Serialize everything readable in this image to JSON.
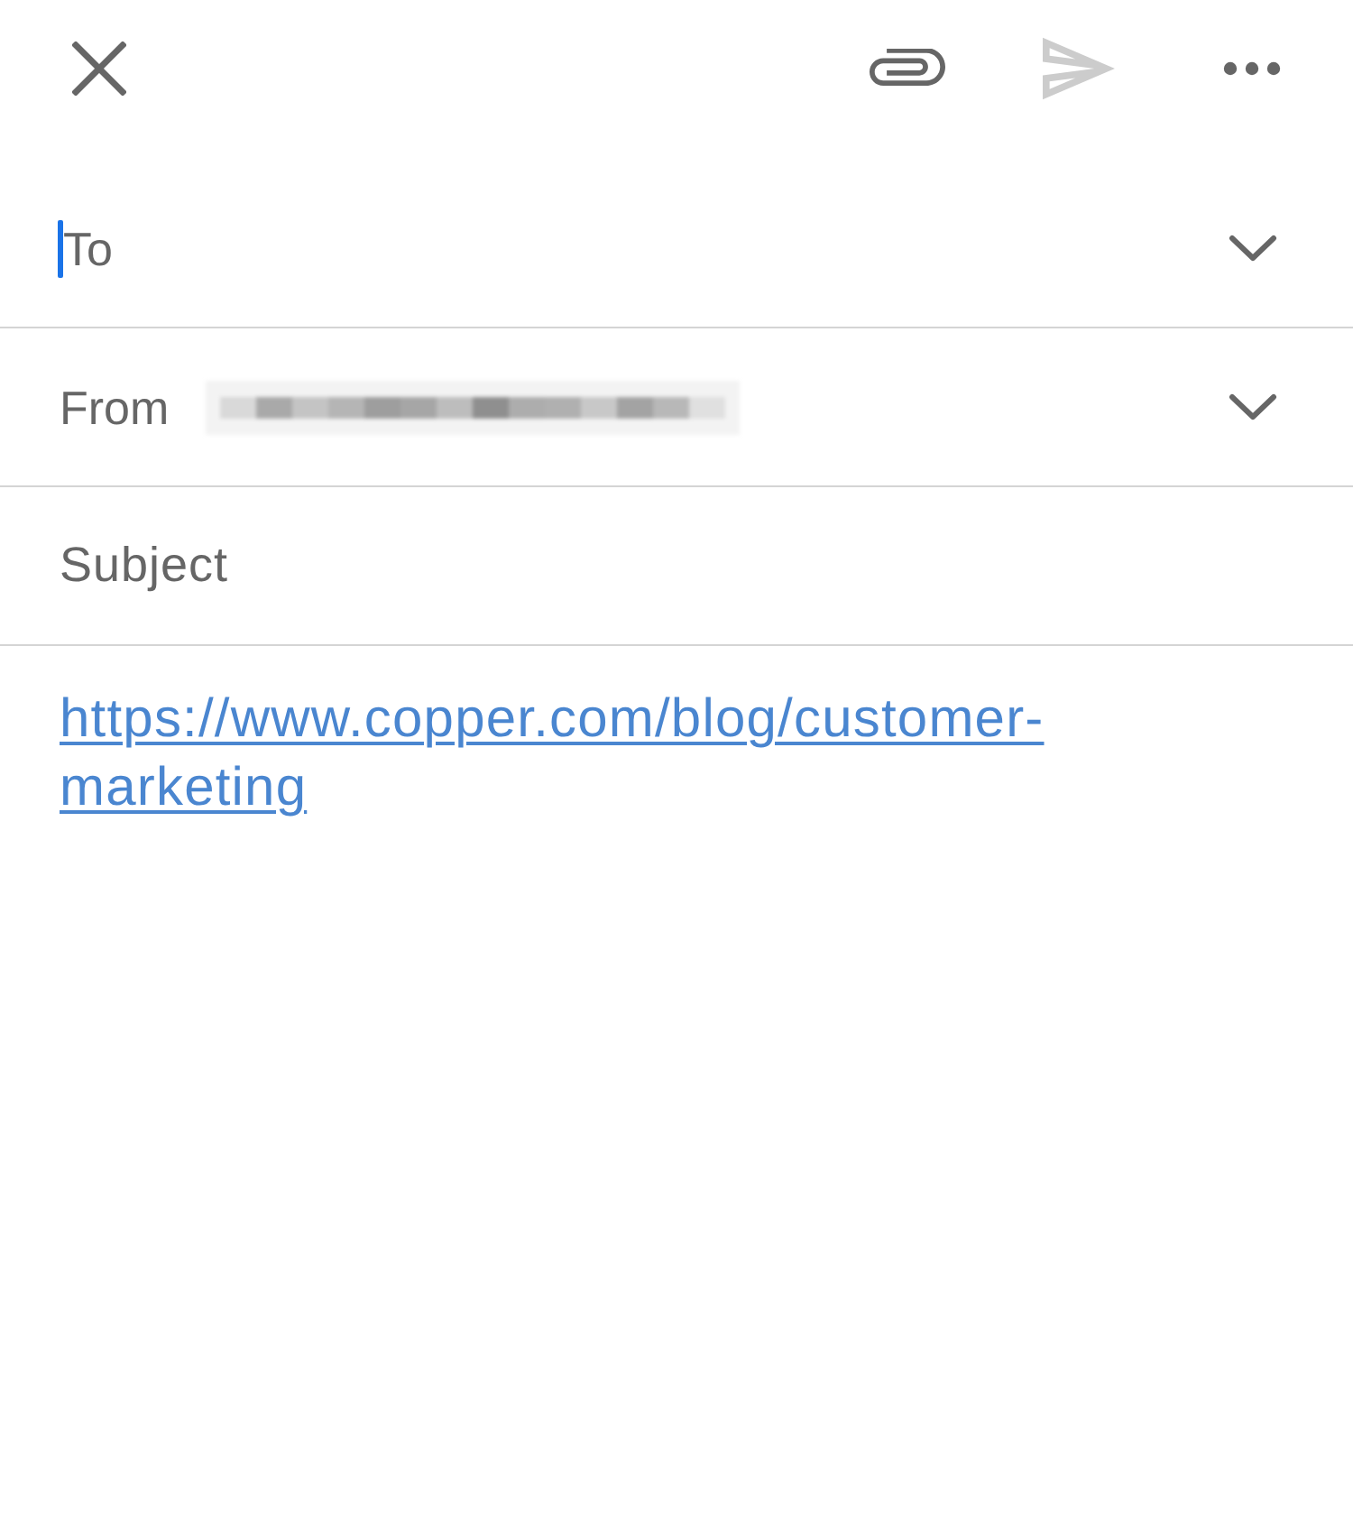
{
  "toolbar": {
    "send": {
      "disabled": true
    }
  },
  "fields": [
    {
      "kind": "recipient",
      "label": "To",
      "focused": true
    },
    {
      "kind": "sender",
      "label": "From",
      "focused": false
    },
    {
      "kind": "subject",
      "placeholder": "Subject",
      "focused": false
    }
  ],
  "body": {
    "link": "https://www.copper.com/blog/customer-marketing"
  }
}
